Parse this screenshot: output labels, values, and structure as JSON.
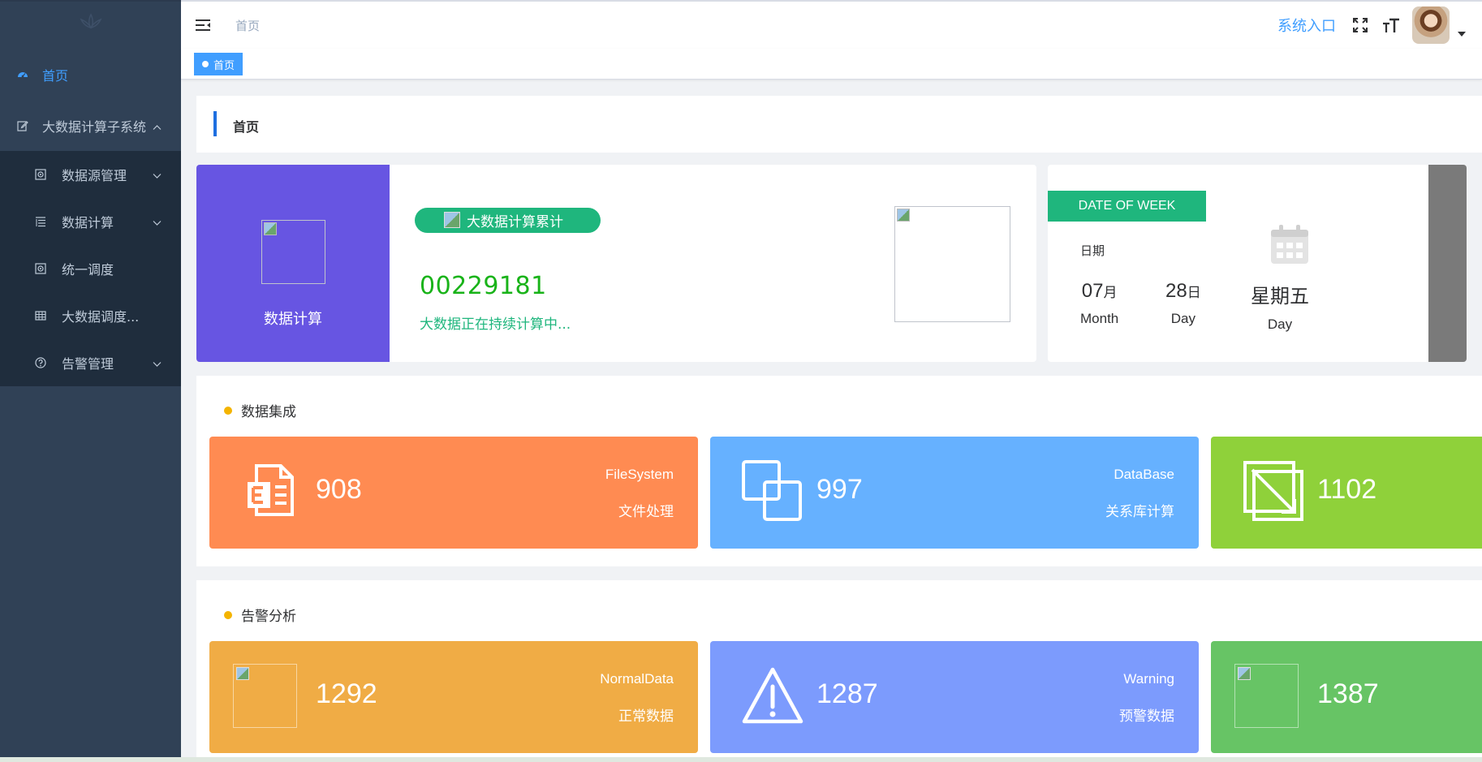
{
  "sidebar": {
    "items": [
      {
        "label": "首页",
        "icon": "dashboard-icon",
        "active": true
      },
      {
        "label": "大数据计算子系统",
        "icon": "edit-icon",
        "expanded": true
      }
    ],
    "submenu": [
      {
        "label": "数据源管理",
        "icon": "database-icon",
        "has_arrow": true
      },
      {
        "label": "数据计算",
        "icon": "list-icon",
        "has_arrow": true
      },
      {
        "label": "统一调度",
        "icon": "schedule-icon",
        "has_arrow": false
      },
      {
        "label": "大数据调度...",
        "icon": "table-icon",
        "has_arrow": false
      },
      {
        "label": "告警管理",
        "icon": "question-icon",
        "has_arrow": true
      }
    ]
  },
  "topbar": {
    "breadcrumb": "首页",
    "system_entry": "系统入口"
  },
  "tags": {
    "active": "首页"
  },
  "page": {
    "title": "首页"
  },
  "stat": {
    "left_label": "数据计算",
    "pill": "大数据计算累计",
    "number": "00229181",
    "subtext": "大数据正在持续计算中..."
  },
  "date": {
    "banner": "DATE OF WEEK",
    "label": "日期",
    "month_value": "07",
    "month_suffix": "月",
    "month_unit": "Month",
    "day_value": "28",
    "day_suffix": "日",
    "day_unit": "Day",
    "weekday": "星期五",
    "weekday_unit": "Day"
  },
  "integration": {
    "title": "数据集成",
    "tiles": [
      {
        "num": "908",
        "en": "FileSystem",
        "cn": "文件处理",
        "color": "#ff8b52",
        "icon": "file-icon"
      },
      {
        "num": "997",
        "en": "DataBase",
        "cn": "关系库计算",
        "color": "#66b1ff",
        "icon": "copy-icon"
      },
      {
        "num": "1102",
        "en": "",
        "cn": "",
        "color": "#8fd13a",
        "icon": "resize-icon"
      }
    ]
  },
  "alerts": {
    "title": "告警分析",
    "tiles": [
      {
        "num": "1292",
        "en": "NormalData",
        "cn": "正常数据",
        "color": "#f0ac45",
        "icon": "broken-image-icon"
      },
      {
        "num": "1287",
        "en": "Warning",
        "cn": "预警数据",
        "color": "#7c9bfd",
        "icon": "warning-icon"
      },
      {
        "num": "1387",
        "en": "",
        "cn": "",
        "color": "#67c465",
        "icon": "broken-image-icon"
      }
    ]
  }
}
